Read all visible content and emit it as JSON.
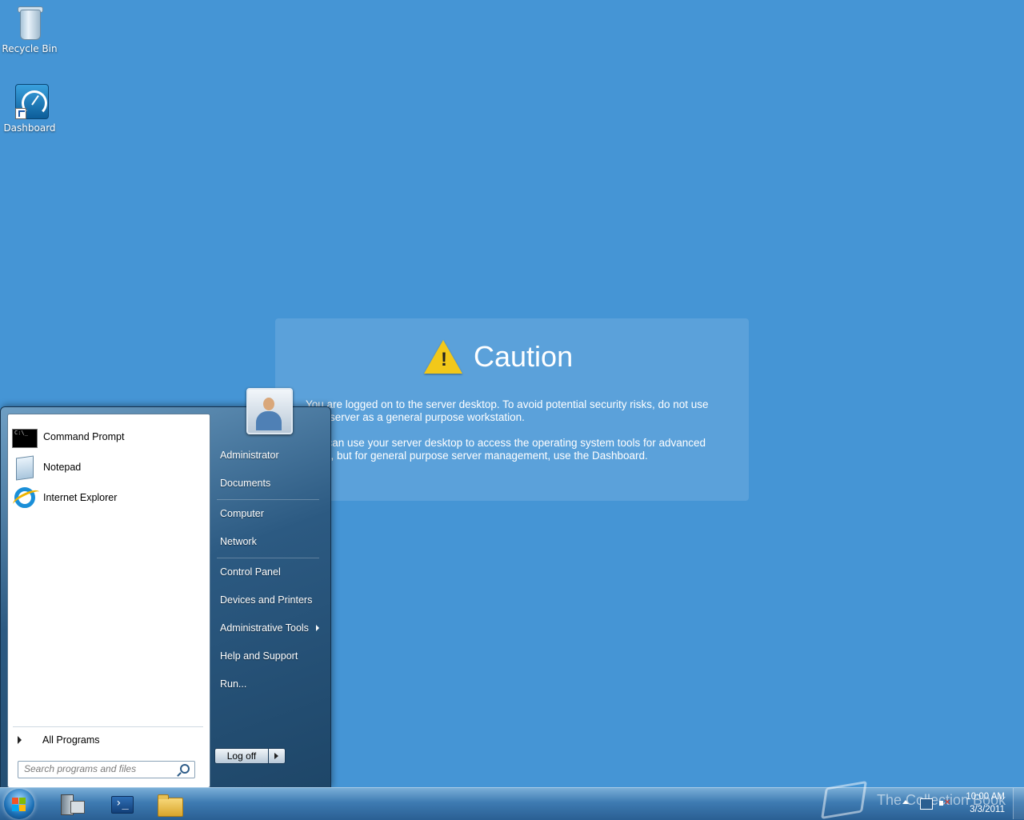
{
  "desktop": {
    "icons": [
      {
        "label": "Recycle Bin"
      },
      {
        "label": "Dashboard"
      }
    ]
  },
  "caution": {
    "title": "Caution",
    "paragraph1": "You are logged on to the server desktop. To avoid potential security risks, do not use your server as a general purpose workstation.",
    "paragraph2": "You can use your server desktop to access the operating system tools for advanced tasks, but for general purpose server management, use the Dashboard."
  },
  "start_menu": {
    "programs": [
      {
        "label": "Command Prompt"
      },
      {
        "label": "Notepad"
      },
      {
        "label": "Internet Explorer"
      }
    ],
    "all_programs": "All Programs",
    "search_placeholder": "Search programs and files",
    "right_items": [
      {
        "label": "Administrator"
      },
      {
        "label": "Documents"
      },
      {
        "label": "Computer"
      },
      {
        "label": "Network"
      },
      {
        "label": "Control Panel"
      },
      {
        "label": "Devices and Printers"
      },
      {
        "label": "Administrative Tools"
      },
      {
        "label": "Help and Support"
      },
      {
        "label": "Run..."
      }
    ],
    "logoff_label": "Log off"
  },
  "taskbar": {
    "clock_time": "10:00 AM",
    "clock_date": "3/3/2011"
  },
  "watermark": {
    "text": "The Collection Book"
  },
  "colors": {
    "desktop_bg": "#4595d5",
    "warning": "#f2c81a"
  }
}
